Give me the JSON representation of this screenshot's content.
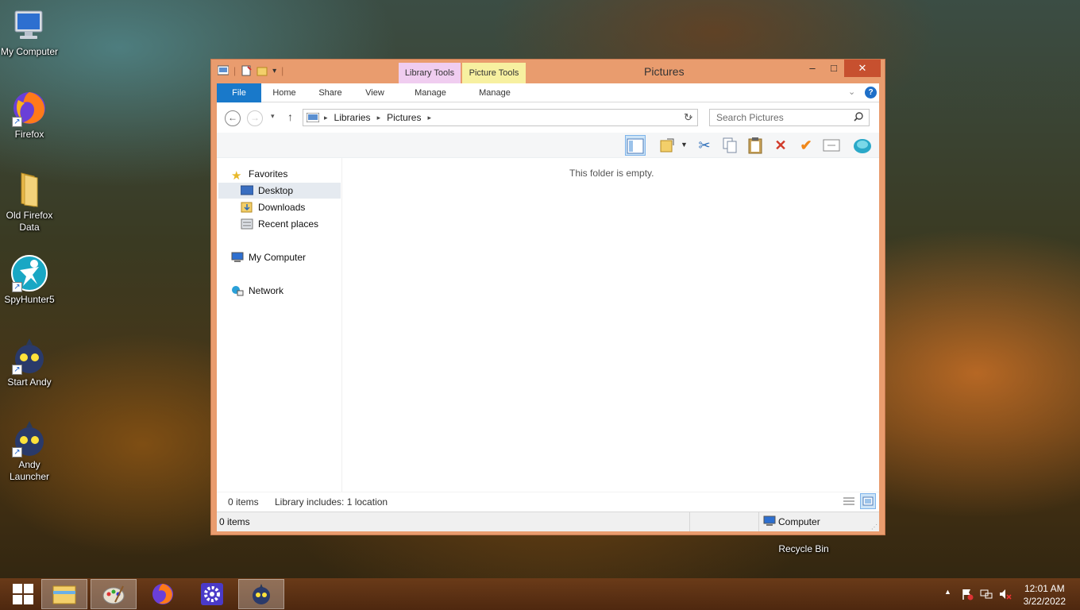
{
  "desktop": {
    "icons": [
      {
        "label": "My Computer"
      },
      {
        "label": "Firefox"
      },
      {
        "label": "Old Firefox Data"
      },
      {
        "label": "SpyHunter5"
      },
      {
        "label": "Start Andy"
      },
      {
        "label": "Andy Launcher"
      },
      {
        "label": "Recycle Bin"
      }
    ]
  },
  "window": {
    "title": "Pictures",
    "context_tabs": {
      "library_tools": "Library Tools",
      "picture_tools": "Picture Tools"
    },
    "ribbon_tabs": {
      "file": "File",
      "home": "Home",
      "share": "Share",
      "view": "View",
      "manage_library": "Manage",
      "manage_picture": "Manage"
    },
    "controls": {
      "minimize": "–",
      "maximize": "□",
      "close": "✕",
      "help": "?"
    },
    "address": {
      "segments": [
        "Libraries",
        "Pictures"
      ]
    },
    "search": {
      "placeholder": "Search Pictures"
    },
    "nav_pane": {
      "favorites": "Favorites",
      "desktop": "Desktop",
      "downloads": "Downloads",
      "recent_places": "Recent places",
      "my_computer": "My Computer",
      "network": "Network"
    },
    "empty_message": "This folder is empty.",
    "details": {
      "items": "0 items",
      "library_info": "Library includes: 1 location"
    },
    "status": {
      "items": "0 items",
      "location": "Computer"
    }
  },
  "taskbar": {
    "clock": {
      "time": "12:01 AM",
      "date": "3/22/2022"
    },
    "apps": [
      "start-icon",
      "file-explorer-icon",
      "paint-icon",
      "firefox-icon",
      "settings-gear-icon",
      "andy-icon"
    ]
  },
  "colors": {
    "window_frame": "#e99c6e",
    "file_tab": "#1979ca",
    "library_tools_tab": "#f0cdf0",
    "picture_tools_tab": "#f7f0a0",
    "close_button": "#c7502f"
  }
}
